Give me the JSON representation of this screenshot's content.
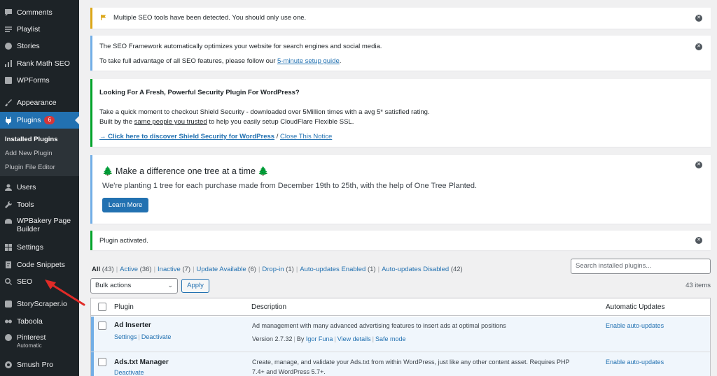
{
  "sidebar": {
    "items": [
      {
        "label": "Comments",
        "icon": "comments-icon"
      },
      {
        "label": "Playlist",
        "icon": "playlist-icon"
      },
      {
        "label": "Stories",
        "icon": "stories-icon"
      },
      {
        "label": "Rank Math SEO",
        "icon": "rank-math-icon"
      },
      {
        "label": "WPForms",
        "icon": "wpforms-icon"
      },
      {
        "label": "Appearance",
        "icon": "brush-icon"
      },
      {
        "label": "Plugins",
        "icon": "plugin-icon",
        "badge": "6"
      },
      {
        "label": "Users",
        "icon": "users-icon"
      },
      {
        "label": "Tools",
        "icon": "wrench-icon"
      },
      {
        "label": "WPBakery Page Builder",
        "label_line1": "WPBakery Page",
        "label_line2": "Builder",
        "icon": "wpbakery-icon"
      },
      {
        "label": "Settings",
        "icon": "settings-icon"
      },
      {
        "label": "Code Snippets",
        "icon": "code-snippets-icon"
      },
      {
        "label": "SEO",
        "icon": "search-icon"
      },
      {
        "label": "StoryScraper.io",
        "icon": "storyscraper-icon"
      },
      {
        "label": "Taboola",
        "icon": "taboola-icon"
      },
      {
        "label": "Pinterest",
        "sublabel": "Automatic",
        "icon": "pinterest-icon"
      },
      {
        "label": "Smush Pro",
        "icon": "smush-icon"
      }
    ],
    "plugins_submenu": [
      "Installed Plugins",
      "Add New Plugin",
      "Plugin File Editor"
    ]
  },
  "notices": {
    "seo_conflict": "Multiple SEO tools have been detected. You should only use one.",
    "seo_framework": {
      "line1": "The SEO Framework automatically optimizes your website for search engines and social media.",
      "line2_prefix": "To take full advantage of all SEO features, please follow our ",
      "line2_link": "5-minute setup guide",
      "line2_suffix": "."
    },
    "shield": {
      "title": "Looking For A Fresh, Powerful Security Plugin For WordPress?",
      "line1": "Take a quick moment to checkout Shield Security - downloaded over 5Million times with a avg 5* satisfied rating.",
      "line2_prefix": "Built by the ",
      "line2_link": "same people you trusted",
      "line2_suffix": " to help you easily setup CloudFlare Flexible SSL.",
      "discover_link": "→ Click here to discover Shield Security for WordPress",
      "separator": "/",
      "close_link": "Close This Notice"
    },
    "trees": {
      "title": "🌲 Make a difference one tree at a time 🌲",
      "text": "We're planting 1 tree for each purchase made from December 19th to 25th, with the help of One Tree Planted.",
      "button": "Learn More"
    },
    "activated": "Plugin activated."
  },
  "filters": [
    {
      "label": "All",
      "count": "(43)",
      "current": true
    },
    {
      "label": "Active",
      "count": "(36)"
    },
    {
      "label": "Inactive",
      "count": "(7)"
    },
    {
      "label": "Update Available",
      "count": "(6)"
    },
    {
      "label": "Drop-in",
      "count": "(1)"
    },
    {
      "label": "Auto-updates Enabled",
      "count": "(1)"
    },
    {
      "label": "Auto-updates Disabled",
      "count": "(42)"
    }
  ],
  "search": {
    "placeholder": "Search installed plugins..."
  },
  "bulk": {
    "selected": "Bulk actions",
    "apply": "Apply",
    "items_count": "43 items"
  },
  "table": {
    "headers": {
      "plugin": "Plugin",
      "description": "Description",
      "auto": "Automatic Updates"
    },
    "rows": [
      {
        "name": "Ad Inserter",
        "actions": [
          "Settings",
          "Deactivate"
        ],
        "description": "Ad management with many advanced advertising features to insert ads at optimal positions",
        "version": "Version 2.7.32",
        "by_prefix": "By ",
        "author": "Igor Funa",
        "view_details": "View details",
        "safe_mode": "Safe mode",
        "auto": "Enable auto-updates"
      },
      {
        "name": "Ads.txt Manager",
        "actions": [
          "Deactivate"
        ],
        "description_line1": "Create, manage, and validate your Ads.txt from within WordPress, just like any other content asset. Requires PHP",
        "description_line2": "7.4+ and WordPress 5.7+.",
        "auto": "Enable auto-updates"
      }
    ]
  },
  "colors": {
    "admin_bar": "#1d2327",
    "accent": "#2271b1",
    "badge": "#d63638",
    "annotation_arrow": "#e02b27"
  }
}
